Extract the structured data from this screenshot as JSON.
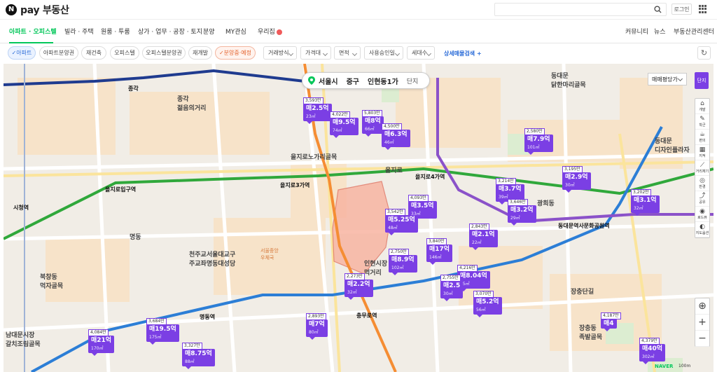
{
  "brand": {
    "n": "N",
    "name": "pay 부동산"
  },
  "header": {
    "login": "로그인"
  },
  "nav": {
    "items": [
      "아파트 · 오피스텔",
      "빌라 · 주택",
      "원룸 · 투룸",
      "상가 · 업무 · 공장 · 토지",
      "분양",
      "MY관심",
      "우리집"
    ],
    "right": [
      "커뮤니티",
      "뉴스",
      "부동산관리센터"
    ]
  },
  "filters": {
    "chips": [
      "아파트",
      "아파트분양권",
      "재건축",
      "오피스텔",
      "오피스텔분양권",
      "재개발",
      "분양중·예정"
    ],
    "dropdowns": [
      "거래방식",
      "가격대",
      "면적",
      "사용승인일",
      "세대수"
    ],
    "advanced": "상세매물검색 +"
  },
  "location": {
    "city": "서울시",
    "district": "중구",
    "dong": "인현동1가",
    "danji": "단지"
  },
  "map_type": "매매평당가",
  "map_toggle": "단지",
  "tools": [
    "개발",
    "학군",
    "편의",
    "지적",
    "거리재기",
    "반경",
    "공유",
    "로드뷰",
    "지도옵션"
  ],
  "scale": "100m",
  "naver": "NAVER",
  "labels": {
    "jonggak": "종각",
    "jongno": "종각\n젊음의거리",
    "euljiro_ent": "을지로입구역",
    "euljiro3": "을지로3가역",
    "euljiro4": "을지로4가역",
    "euljiro": "을지로",
    "myeongdong": "명동",
    "myeongdong_st": "명동역",
    "chungmuro": "충무로역",
    "inhyeon": "인현시장\n먹거리",
    "dongdaemun": "동대문\n닭한마리골목",
    "ddp": "동대문\n디자인플라자",
    "ddp_st": "동대문역사문화공원역",
    "jangchung": "장충단길",
    "jokbal": "장충동\n족발골목",
    "namdaemun": "남대문시장\n갈치조림골목",
    "bukchang": "북창동\n먹자골목",
    "cathedral": "천주교서울대교구\n주교좌명동대성당",
    "city_hall": "시청역",
    "gwanghui": "광희동",
    "euljiro_st": "을지로노가리골목",
    "seoul_st": "서울중앙\n우체국"
  },
  "markers": [
    {
      "price": "매2.5억",
      "sub": "23㎡",
      "top": "3,593만"
    },
    {
      "price": "매9.5억",
      "sub": "74㎡",
      "top": "4,022만"
    },
    {
      "price": "매8억",
      "sub": "66㎡",
      "top": "5,803만"
    },
    {
      "price": "매6.3억",
      "sub": "46㎡",
      "top": "4,500만"
    },
    {
      "price": "매7.9억",
      "sub": "101㎡",
      "top": "2,580만"
    },
    {
      "price": "매2.9억",
      "sub": "30㎡",
      "top": "3,195만"
    },
    {
      "price": "매3.7억",
      "sub": "39㎡",
      "top": "3,214만"
    },
    {
      "price": "매3.2억",
      "sub": "29㎡",
      "top": "3,646만"
    },
    {
      "price": "매3.1억",
      "sub": "32㎡",
      "top": "3,202만"
    },
    {
      "price": "매3.5억",
      "sub": "33㎡",
      "top": "4,093만"
    },
    {
      "price": "매5.25억",
      "sub": "48㎡",
      "top": "3,542만"
    },
    {
      "price": "매2.1억",
      "sub": "22㎡",
      "top": "2,843만"
    },
    {
      "price": "매17억",
      "sub": "146㎡",
      "top": "3,840만"
    },
    {
      "price": "매8.9억",
      "sub": "102㎡",
      "top": "2,750만"
    },
    {
      "price": "매8.04억",
      "sub": "75㎡",
      "top": "4,216만"
    },
    {
      "price": "매2.5",
      "sub": "30㎡",
      "top": "2,755만"
    },
    {
      "price": "매5.2억",
      "sub": "56㎡",
      "top": "3,070만"
    },
    {
      "price": "매2.2억",
      "sub": "32㎡",
      "top": "2,273만"
    },
    {
      "price": "매7억",
      "sub": "80㎡",
      "top": "2,893만"
    },
    {
      "price": "매19.5억",
      "sub": "175㎡",
      "top": "3,684만"
    },
    {
      "price": "매21억",
      "sub": "170㎡",
      "top": "4,084만"
    },
    {
      "price": "매8.75억",
      "sub": "88㎡",
      "top": "3,327만"
    },
    {
      "price": "매40억",
      "sub": "302㎡",
      "top": "4,379만"
    },
    {
      "price": "매4",
      "sub": "",
      "top": "4,187만"
    }
  ],
  "colors": {
    "accent": "#03c75a",
    "marker": "#7b3fe4",
    "line2": "#30a83b",
    "line3": "#f58d33",
    "line4": "#2c7ed6",
    "line5": "#8b52c9",
    "line1": "#1f3b8f"
  }
}
